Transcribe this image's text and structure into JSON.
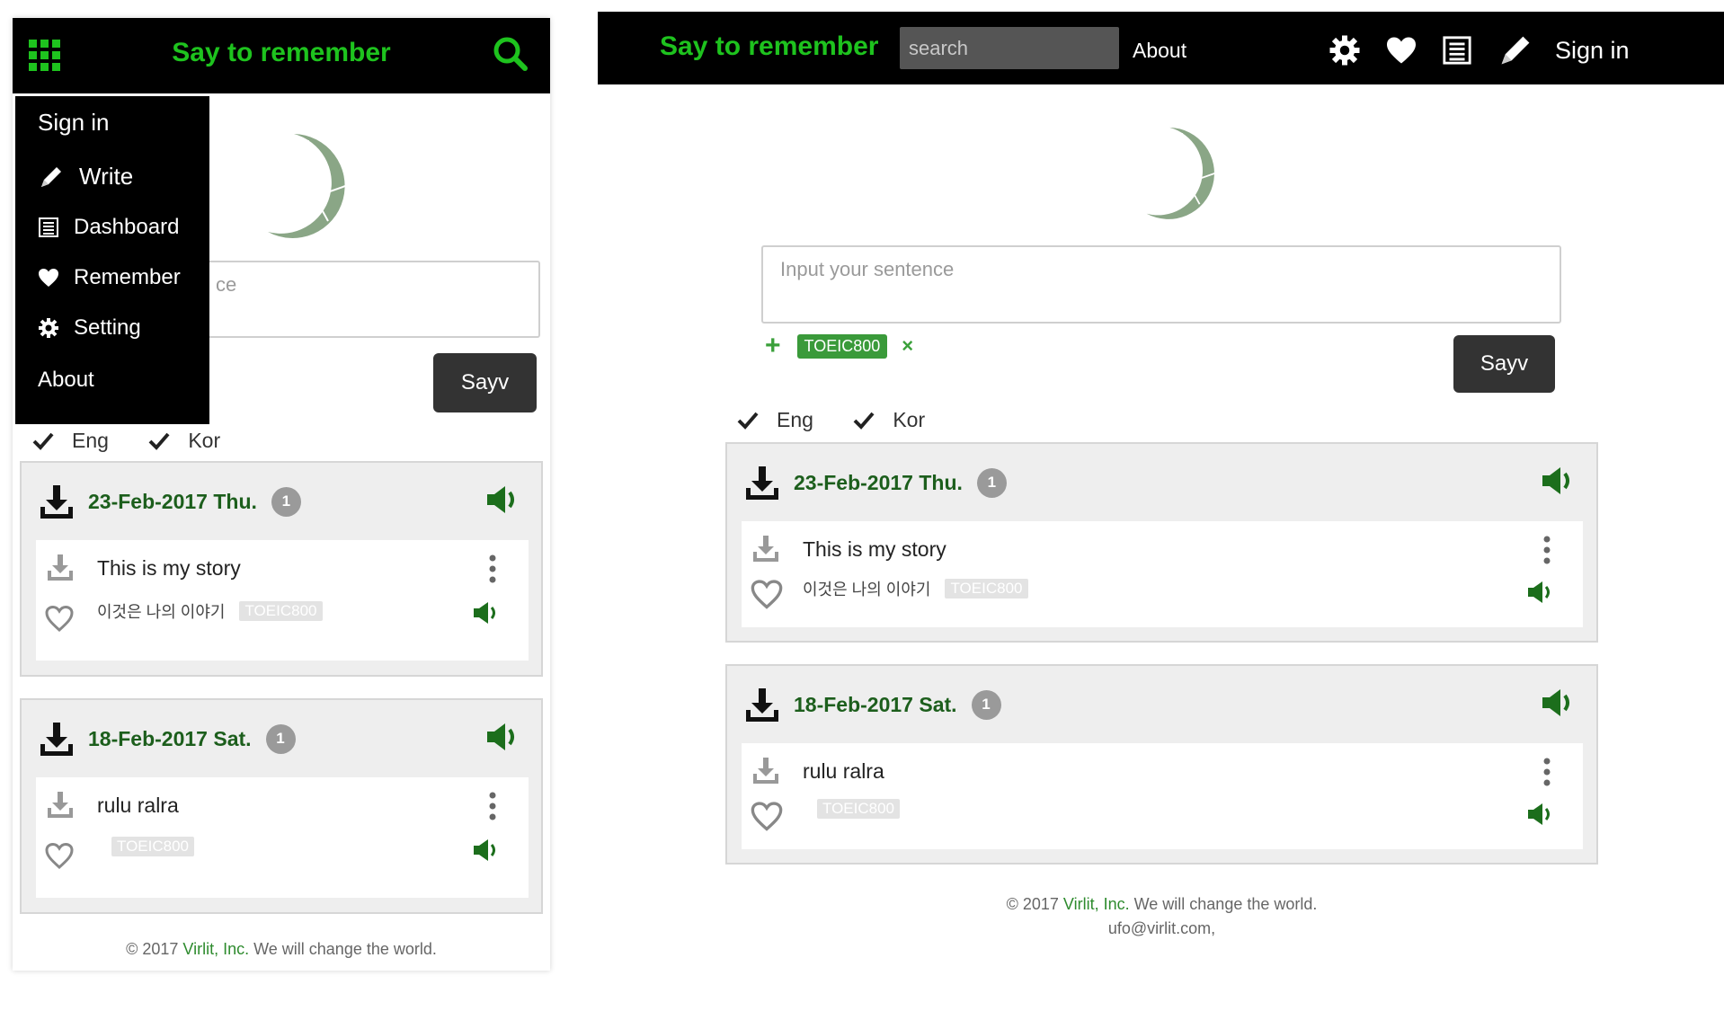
{
  "brand": "Say to remember",
  "colors": {
    "brand_green": "#1ec31e",
    "date_green": "#1c5e1c",
    "tag_green": "#3a9a3a",
    "moon": "#8aa686"
  },
  "icons": [
    "grid-icon",
    "search-icon",
    "pencil-icon",
    "list-icon",
    "heart-icon",
    "gear-icon",
    "download-icon",
    "speaker-icon",
    "more-vertical-icon",
    "check-icon",
    "plus-icon",
    "close-icon",
    "moon-logo"
  ],
  "mobile": {
    "menu": {
      "sign_in": "Sign in",
      "write": "Write",
      "dashboard": "Dashboard",
      "remember": "Remember",
      "setting": "Setting",
      "about": "About"
    },
    "input_visible_text": "ce"
  },
  "desktop": {
    "search_placeholder": "search",
    "about": "About",
    "sign_in": "Sign in",
    "input_placeholder": "Input your sentence",
    "selected_tag": "TOEIC800"
  },
  "sayv_label": "Sayv",
  "langs": {
    "eng": "Eng",
    "kor": "Kor"
  },
  "days": [
    {
      "date": "23-Feb-2017 Thu.",
      "count": "1",
      "entry": {
        "en": "This is my story",
        "ko": "이것은 나의 이야기",
        "tag": "TOEIC800"
      }
    },
    {
      "date": "18-Feb-2017 Sat.",
      "count": "1",
      "entry": {
        "en": "rulu ralra",
        "ko": "",
        "tag": "TOEIC800"
      }
    }
  ],
  "footer": {
    "copyright": "© 2017 ",
    "company": "Virlit, Inc.",
    "tagline": " We will change the world.",
    "email": "ufo@virlit.com,"
  }
}
